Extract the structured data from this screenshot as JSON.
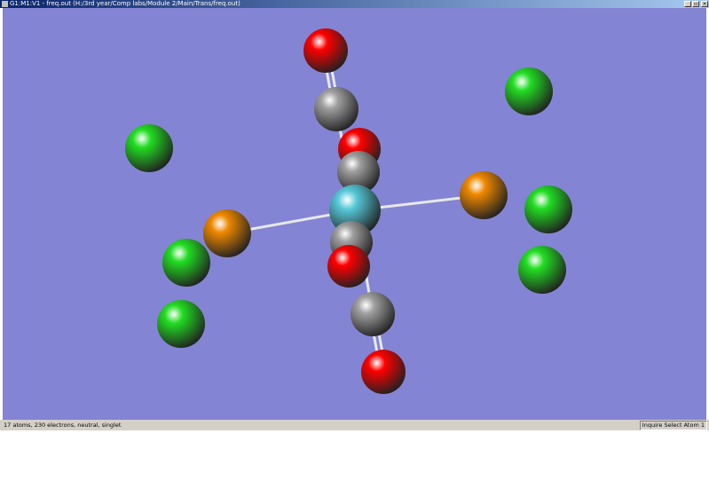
{
  "window": {
    "title": "G1:M1:V1 - freq.out (H:/3rd year/Comp labs/Module 2/Main/Trans/freq.out)"
  },
  "status": {
    "left": "17 atoms, 230 electrons, neutral, singlet",
    "right": "Inquire Select Atom 1"
  },
  "colors": {
    "background": "#8484d4",
    "O": "#ff0000",
    "C": "#a0a0a0",
    "Cl": "#22dd22",
    "Br": "#ee8800",
    "Ru": "#55c8d8"
  }
}
